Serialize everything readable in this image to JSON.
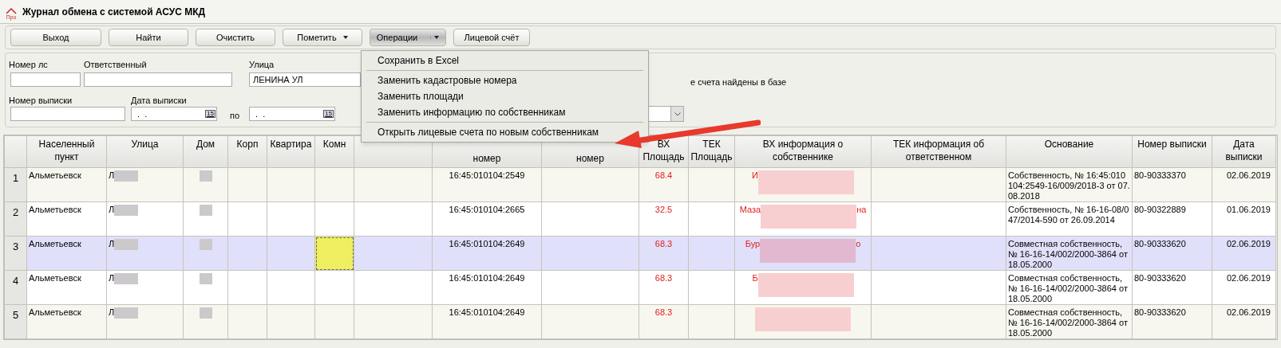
{
  "window": {
    "title": "Журнал обмена с системой АСУС МКД",
    "logo_text": "Про"
  },
  "toolbar": [
    {
      "label": "Выход",
      "kind": "button"
    },
    {
      "label": "Найти",
      "kind": "button"
    },
    {
      "label": "Очистить",
      "kind": "button"
    },
    {
      "label": "Пометить",
      "kind": "dropdown",
      "expanded": false
    },
    {
      "label": "Операции",
      "kind": "split",
      "expanded": true
    },
    {
      "label": "Лицевой счёт",
      "kind": "button"
    }
  ],
  "filters": {
    "account": {
      "label": "Номер лс"
    },
    "responsible": {
      "label": "Ответственный"
    },
    "street": {
      "label": "Улица",
      "value": "ЛЕНИНА УЛ"
    },
    "found_note": "е счета найдены в базе",
    "statement_number": {
      "label": "Номер выписки"
    },
    "statement_date": {
      "label": "Дата  выписки",
      "from": " .  .",
      "calendar_from": "15",
      "separator": "по",
      "to": " .  .",
      "calendar_to": "15"
    }
  },
  "menu": {
    "items": [
      {
        "label": "Сохранить в Excel",
        "separator_after": true
      },
      {
        "label": "Заменить кадастровые номера",
        "separator_after": false
      },
      {
        "label": "Заменить площади",
        "separator_after": false
      },
      {
        "label": "Заменить информацию по собственникам",
        "separator_after": true
      },
      {
        "label": "Открыть лицевые счета по новым собственникам",
        "separator_after": false
      }
    ]
  },
  "table": {
    "columns": [
      "Населенный пункт",
      "Улица",
      "Дом",
      "Корп",
      "Квартира",
      "Комн",
      "",
      "номер",
      "номер",
      "ВХ Площадь",
      "ТЕК Площадь",
      "ВХ информация о собственнике",
      "ТЕК информация об ответственном",
      "Основание",
      "Номер выписки",
      "Дата выписки"
    ],
    "rows": [
      {
        "number": "1",
        "selected": false,
        "alt": true,
        "cells": [
          "Альметьевск",
          "Л",
          "",
          "",
          "",
          "",
          "",
          "16:45:010104:2549",
          "",
          "68.4",
          "",
          {
            "start": "И"
          },
          "",
          "Собственность, № 16:45:010104:2549-16/009/2018-3 от 07.08.2018",
          "80-90333370",
          "02.06.2019"
        ]
      },
      {
        "number": "2",
        "selected": false,
        "alt": false,
        "cells": [
          "Альметьевск",
          "Л",
          "",
          "",
          "",
          "",
          "",
          "16:45:010104:2665",
          "",
          "32.5",
          "",
          {
            "start": "Маза",
            "end": "на"
          },
          "",
          "Собственность, № 16-16-08/047/2014-590 от 26.09.2014",
          "80-90322889",
          "01.06.2019"
        ]
      },
      {
        "number": "3",
        "selected": true,
        "alt": false,
        "cells": [
          "Альметьевск",
          "Л",
          "",
          "",
          "",
          "",
          "",
          "16:45:010104:2649",
          "",
          "68.3",
          "",
          {
            "start": "Бур",
            "end": "о"
          },
          "",
          "Совместная собственность, № 16-16-14/002/2000-3864 от 18.05.2000",
          "80-90333620",
          "02.06.2019"
        ]
      },
      {
        "number": "4",
        "selected": false,
        "alt": false,
        "cells": [
          "Альметьевск",
          "Л",
          "",
          "",
          "",
          "",
          "",
          "16:45:010104:2649",
          "",
          "68.3",
          "",
          {
            "start": "Б"
          },
          "",
          "Совместная собственность, № 16-16-14/002/2000-3864 от 18.05.2000",
          "80-90333620",
          "02.06.2019"
        ]
      },
      {
        "number": "5",
        "selected": false,
        "alt": true,
        "cells": [
          "Альметьевск",
          "Л",
          "",
          "",
          "",
          "",
          "",
          "16:45:010104:2649",
          "",
          "68.3",
          "",
          {},
          "",
          "Совместная собственность, № 16-16-14/002/2000-3864 от 18.05.2000",
          "80-90333620",
          "02.06.2019"
        ]
      }
    ]
  }
}
